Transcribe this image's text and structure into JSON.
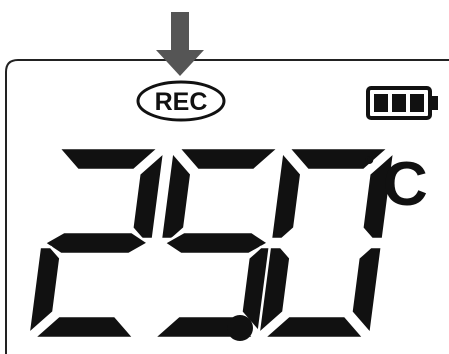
{
  "display": {
    "rec_label": "REC",
    "temperature_value": "25.0",
    "unit_degree_symbol": "°",
    "unit_letter": "C",
    "digits": [
      "2",
      "5",
      "0"
    ],
    "battery_level_fraction": 1.0
  },
  "colors": {
    "segment": "#111111",
    "segment_edge": "#ffffff",
    "arrow": "#555555",
    "frame": "#222222",
    "background": "#ffffff"
  },
  "icons": {
    "indicator_arrow": "down-arrow-icon",
    "battery": "battery-icon"
  }
}
